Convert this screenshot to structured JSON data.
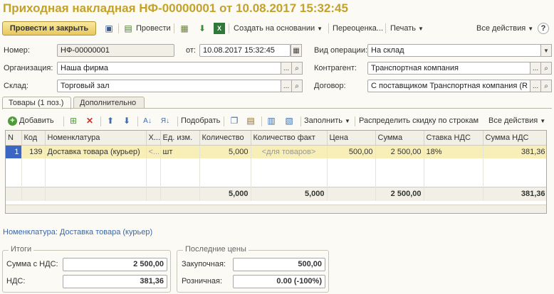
{
  "title": "Приходная накладная НФ-00000001 от 10.08.2017 15:32:45",
  "toolbar": {
    "post_close": "Провести и закрыть",
    "post": "Провести",
    "create_based": "Создать на основании",
    "revalue": "Переоценка...",
    "print": "Печать",
    "all_actions": "Все действия",
    "help": "?"
  },
  "form": {
    "number_label": "Номер:",
    "number_value": "НФ-00000001",
    "date_label": "от:",
    "date_value": "10.08.2017 15:32:45",
    "operation_label": "Вид операции:",
    "operation_value": "На склад",
    "org_label": "Организация:",
    "org_value": "Наша фирма",
    "contractor_label": "Контрагент:",
    "contractor_value": "Транспортная компания",
    "warehouse_label": "Склад:",
    "warehouse_value": "Торговый зал",
    "contract_label": "Договор:",
    "contract_value": "С поставщиком Транспортная компания (R"
  },
  "tabs": [
    {
      "label": "Товары (1 поз.)",
      "active": true
    },
    {
      "label": "Дополнительно",
      "active": false
    }
  ],
  "grid_toolbar": {
    "add": "Добавить",
    "pick": "Подобрать",
    "fill": "Заполнить",
    "distribute": "Распределить скидку по строкам",
    "all_actions": "Все действия"
  },
  "table": {
    "columns": [
      "N",
      "Код",
      "Номенклатура",
      "Х...",
      "Ед. изм.",
      "Количество",
      "Количество факт",
      "Цена",
      "Сумма",
      "Ставка НДС",
      "Сумма НДС"
    ],
    "rows": [
      [
        "1",
        "139",
        "Доставка товара (курьер)",
        "<...",
        "шт",
        "5,000",
        "<для товаров>",
        "500,00",
        "2 500,00",
        "18%",
        "381,36"
      ]
    ],
    "footer": [
      "",
      "",
      "",
      "",
      "",
      "5,000",
      "5,000",
      "",
      "2 500,00",
      "",
      "381,36"
    ]
  },
  "nomenclature_line": "Номенклатура: Доставка товара (курьер)",
  "totals": {
    "group_title": "Итоги",
    "sum_label": "Сумма с НДС:",
    "sum_value": "2 500,00",
    "vat_label": "НДС:",
    "vat_value": "381,36"
  },
  "last_prices": {
    "group_title": "Последние цены",
    "purchase_label": "Закупочная:",
    "purchase_value": "500,00",
    "retail_label": "Розничная:",
    "retail_value": "0.00 (-100%)"
  },
  "icons": [
    "save-icon",
    "post-icon",
    "report-icon",
    "download-icon",
    "excel-icon",
    "add-icon",
    "copy-row-icon",
    "delete-icon",
    "move-up-icon",
    "move-down-icon",
    "sort-asc-icon",
    "sort-desc-icon",
    "copy-icon",
    "paste-icon",
    "calendar-icon",
    "search-icon",
    "dropdown-icon"
  ],
  "colors": {
    "title": "#c3a22a",
    "selected_row": "#f7eeb8",
    "primary_button": "#e9c85c",
    "link": "#3b66a8"
  }
}
